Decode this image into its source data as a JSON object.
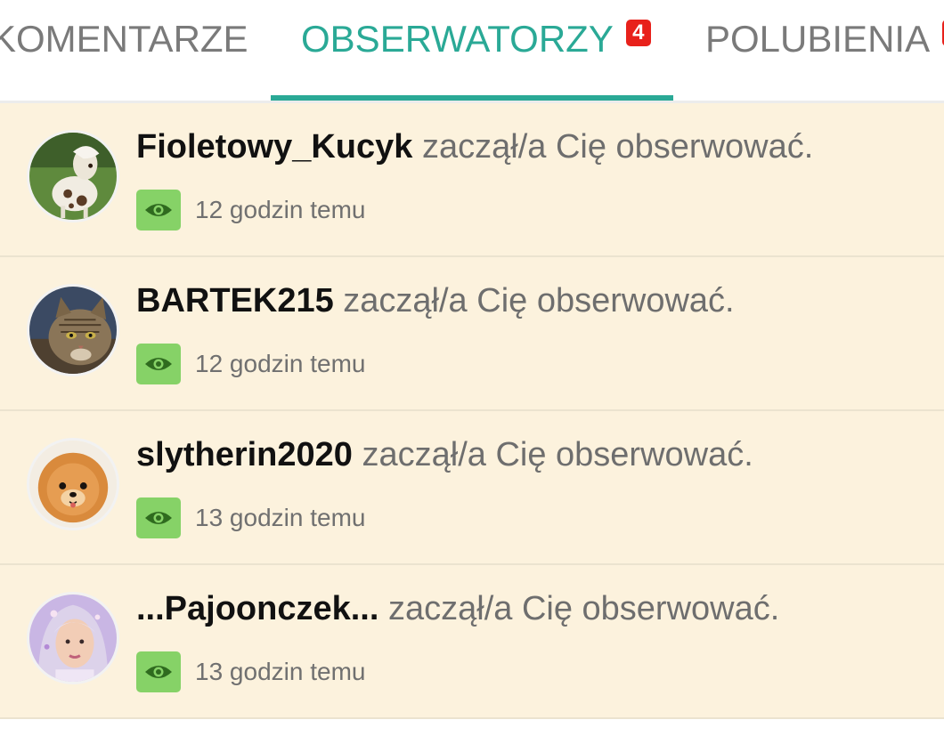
{
  "tabs": [
    {
      "label": "KOMENTARZE",
      "active": false
    },
    {
      "label": "OBSERWATORZY",
      "badge": "4",
      "active": true
    },
    {
      "label": "POLUBIENIA",
      "badge": "",
      "active": false
    }
  ],
  "colors": {
    "accent": "#2aa996",
    "badge": "#e8211b",
    "row_background": "#fcf2dd",
    "eye_badge": "#86d267"
  },
  "notifications": [
    {
      "username": "Fioletowy_Kucyk",
      "action": " zaczął/a Cię obserwować.",
      "time": "12 godzin temu",
      "avatar_icon": "pony-avatar"
    },
    {
      "username": "BARTEK215",
      "action": " zaczął/a Cię obserwować.",
      "time": "12 godzin temu",
      "avatar_icon": "cat-avatar"
    },
    {
      "username": "slytherin2020",
      "action": " zaczął/a Cię obserwować.",
      "time": "13 godzin temu",
      "avatar_icon": "pomeranian-avatar"
    },
    {
      "username": "...Pajoonczek...",
      "action": " zaczął/a Cię obserwować.",
      "time": "13 godzin temu",
      "avatar_icon": "person-avatar"
    }
  ]
}
